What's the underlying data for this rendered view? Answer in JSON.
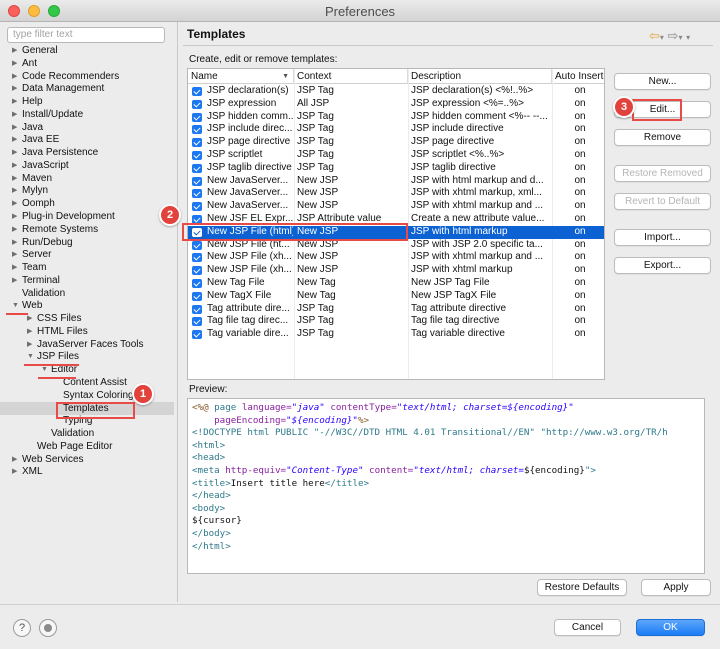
{
  "window": {
    "title": "Preferences"
  },
  "filter": {
    "placeholder": "type filter text"
  },
  "tree": [
    {
      "label": "General",
      "indent": 0,
      "arrow": "right"
    },
    {
      "label": "Ant",
      "indent": 0,
      "arrow": "right"
    },
    {
      "label": "Code Recommenders",
      "indent": 0,
      "arrow": "right"
    },
    {
      "label": "Data Management",
      "indent": 0,
      "arrow": "right"
    },
    {
      "label": "Help",
      "indent": 0,
      "arrow": "right"
    },
    {
      "label": "Install/Update",
      "indent": 0,
      "arrow": "right"
    },
    {
      "label": "Java",
      "indent": 0,
      "arrow": "right"
    },
    {
      "label": "Java EE",
      "indent": 0,
      "arrow": "right"
    },
    {
      "label": "Java Persistence",
      "indent": 0,
      "arrow": "right"
    },
    {
      "label": "JavaScript",
      "indent": 0,
      "arrow": "right"
    },
    {
      "label": "Maven",
      "indent": 0,
      "arrow": "right"
    },
    {
      "label": "Mylyn",
      "indent": 0,
      "arrow": "right"
    },
    {
      "label": "Oomph",
      "indent": 0,
      "arrow": "right"
    },
    {
      "label": "Plug-in Development",
      "indent": 0,
      "arrow": "right"
    },
    {
      "label": "Remote Systems",
      "indent": 0,
      "arrow": "right"
    },
    {
      "label": "Run/Debug",
      "indent": 0,
      "arrow": "right"
    },
    {
      "label": "Server",
      "indent": 0,
      "arrow": "right"
    },
    {
      "label": "Team",
      "indent": 0,
      "arrow": "right"
    },
    {
      "label": "Terminal",
      "indent": 0,
      "arrow": "right"
    },
    {
      "label": "Validation",
      "indent": 0,
      "arrow": ""
    },
    {
      "label": "Web",
      "indent": 0,
      "arrow": "down"
    },
    {
      "label": "CSS Files",
      "indent": 1,
      "arrow": "right"
    },
    {
      "label": "HTML Files",
      "indent": 1,
      "arrow": "right"
    },
    {
      "label": "JavaServer Faces Tools",
      "indent": 1,
      "arrow": "right"
    },
    {
      "label": "JSP Files",
      "indent": 1,
      "arrow": "down"
    },
    {
      "label": "Editor",
      "indent": 2,
      "arrow": "down"
    },
    {
      "label": "Content Assist",
      "indent": 3,
      "arrow": ""
    },
    {
      "label": "Syntax Coloring",
      "indent": 3,
      "arrow": ""
    },
    {
      "label": "Templates",
      "indent": 3,
      "arrow": "",
      "selected": true
    },
    {
      "label": "Typing",
      "indent": 3,
      "arrow": ""
    },
    {
      "label": "Validation",
      "indent": 2,
      "arrow": ""
    },
    {
      "label": "Web Page Editor",
      "indent": 1,
      "arrow": ""
    },
    {
      "label": "Web Services",
      "indent": 0,
      "arrow": "right"
    },
    {
      "label": "XML",
      "indent": 0,
      "arrow": "right"
    }
  ],
  "page": {
    "title": "Templates",
    "description": "Create, edit or remove templates:",
    "nav_back": "⇦",
    "nav_forward": "⇨"
  },
  "table": {
    "columns": [
      "Name",
      "Context",
      "Description",
      "Auto Insert"
    ],
    "rows": [
      {
        "name": "JSP declaration(s)",
        "context": "JSP Tag",
        "description": "JSP declaration(s) <%!..%>",
        "auto": "on"
      },
      {
        "name": "JSP expression",
        "context": "All JSP",
        "description": "JSP expression <%=..%>",
        "auto": "on"
      },
      {
        "name": "JSP hidden comm...",
        "context": "JSP Tag",
        "description": "JSP hidden comment <%-- --...",
        "auto": "on"
      },
      {
        "name": "JSP include direc...",
        "context": "JSP Tag",
        "description": "JSP include directive",
        "auto": "on"
      },
      {
        "name": "JSP page directive",
        "context": "JSP Tag",
        "description": "JSP page directive",
        "auto": "on"
      },
      {
        "name": "JSP scriptlet",
        "context": "JSP Tag",
        "description": "JSP scriptlet <%..%>",
        "auto": "on"
      },
      {
        "name": "JSP taglib directive",
        "context": "JSP Tag",
        "description": "JSP taglib directive",
        "auto": "on"
      },
      {
        "name": "New JavaServer...",
        "context": "New JSP",
        "description": "JSP with html markup and d...",
        "auto": "on"
      },
      {
        "name": "New JavaServer...",
        "context": "New JSP",
        "description": "JSP with xhtml markup, xml...",
        "auto": "on"
      },
      {
        "name": "New JavaServer...",
        "context": "New JSP",
        "description": "JSP with xhtml markup and ...",
        "auto": "on"
      },
      {
        "name": "New JSF EL Expr...",
        "context": "JSP Attribute value",
        "description": "Create a new attribute value...",
        "auto": "on"
      },
      {
        "name": "New JSP File (html)",
        "context": "New JSP",
        "description": "JSP with html markup",
        "auto": "on",
        "selected": true
      },
      {
        "name": "New JSP File (ht...",
        "context": "New JSP",
        "description": "JSP with JSP 2.0 specific ta...",
        "auto": "on"
      },
      {
        "name": "New JSP File (xh...",
        "context": "New JSP",
        "description": "JSP with xhtml markup and ...",
        "auto": "on"
      },
      {
        "name": "New JSP File (xh...",
        "context": "New JSP",
        "description": "JSP with xhtml markup",
        "auto": "on"
      },
      {
        "name": "New Tag File",
        "context": "New Tag",
        "description": "New JSP Tag File",
        "auto": "on"
      },
      {
        "name": "New TagX File",
        "context": "New Tag",
        "description": "New JSP TagX File",
        "auto": "on"
      },
      {
        "name": "Tag attribute dire...",
        "context": "JSP Tag",
        "description": "Tag attribute directive",
        "auto": "on"
      },
      {
        "name": "Tag file tag direc...",
        "context": "JSP Tag",
        "description": "Tag file tag directive",
        "auto": "on"
      },
      {
        "name": "Tag variable dire...",
        "context": "JSP Tag",
        "description": "Tag variable directive",
        "auto": "on"
      }
    ]
  },
  "buttons": {
    "new": "New...",
    "edit": "Edit...",
    "remove": "Remove",
    "restore_removed": "Restore Removed",
    "revert_default": "Revert to Default",
    "import": "Import...",
    "export": "Export...",
    "restore_defaults": "Restore Defaults",
    "apply": "Apply",
    "cancel": "Cancel",
    "ok": "OK"
  },
  "preview": {
    "label": "Preview:",
    "lines": [
      [
        [
          "<%@ ",
          "jsp"
        ],
        [
          "page ",
          "tag"
        ],
        [
          "language=",
          "attr"
        ],
        [
          "\"java\"",
          "str"
        ],
        [
          " contentType=",
          "attr"
        ],
        [
          "\"text/html; charset=${encoding}\"",
          "str"
        ]
      ],
      [
        [
          "    pageEncoding=",
          "attr"
        ],
        [
          "\"${encoding}\"",
          "str"
        ],
        [
          "%>",
          "jsp"
        ]
      ],
      [
        [
          "<!DOCTYPE html PUBLIC \"-//W3C//DTD HTML 4.01 Transitional//EN\" \"http://www.w3.org/TR/h",
          "tag"
        ]
      ],
      [
        [
          "<html>",
          "tag"
        ]
      ],
      [
        [
          "<head>",
          "tag"
        ]
      ],
      [
        [
          "<meta ",
          "tag"
        ],
        [
          "http-equiv=",
          "attr"
        ],
        [
          "\"Content-Type\"",
          "str"
        ],
        [
          " content=",
          "attr"
        ],
        [
          "\"text/html; charset=",
          "str"
        ],
        [
          "${encoding}",
          "plain"
        ],
        [
          "\">",
          "tag"
        ]
      ],
      [
        [
          "<title>",
          "tag"
        ],
        [
          "Insert title here",
          "plain"
        ],
        [
          "</title>",
          "tag"
        ]
      ],
      [
        [
          "</head>",
          "tag"
        ]
      ],
      [
        [
          "<body>",
          "tag"
        ]
      ],
      [
        [
          "${cursor}",
          "plain"
        ]
      ],
      [
        [
          "</body>",
          "tag"
        ]
      ],
      [
        [
          "</html>",
          "tag"
        ]
      ]
    ]
  },
  "annotations": [
    {
      "number": "1"
    },
    {
      "number": "2"
    },
    {
      "number": "3"
    }
  ],
  "colors": {
    "selection": "#0c62d3",
    "annotation_red": "#e84a47",
    "checkbox_blue": "#1b78f2"
  },
  "help_icon": "?"
}
